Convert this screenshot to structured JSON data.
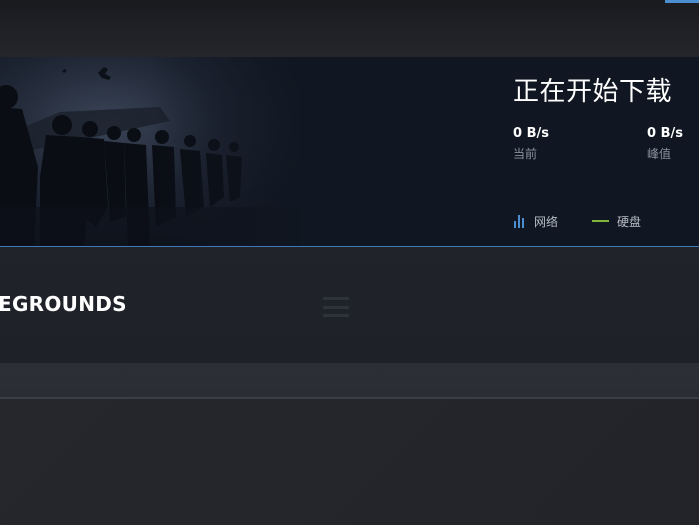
{
  "download_status": {
    "title": "正在开始下载",
    "current_rate": {
      "value": "0 B/s",
      "label": "当前"
    },
    "peak_rate": {
      "value": "0 B/s",
      "label": "峰值"
    },
    "legend": {
      "network_label": "网络",
      "disk_label": "硬盘",
      "network_color": "#4c8fd1",
      "disk_color": "#7fb63a",
      "network_icon": "bar-chart-icon",
      "disk_icon": "line-icon"
    }
  },
  "current_game": {
    "name_visible": "EGROUNDS"
  },
  "colors": {
    "accent": "#4c8fd1",
    "background": "#1f2228",
    "banner_bg": "#111722"
  }
}
